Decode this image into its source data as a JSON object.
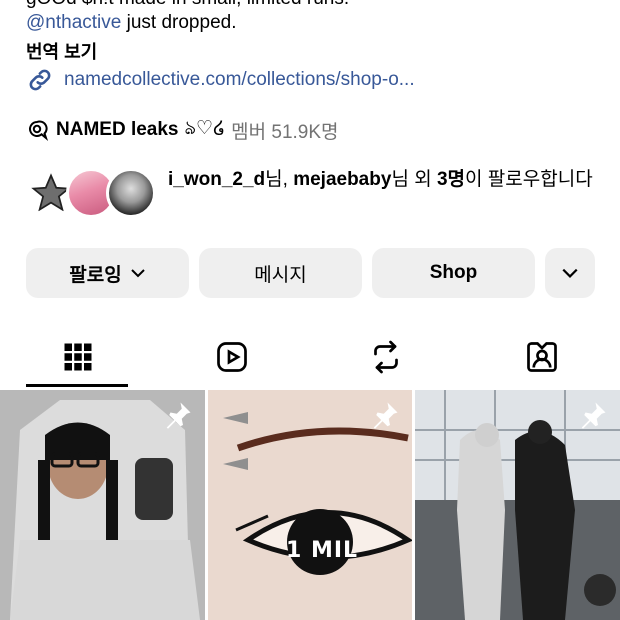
{
  "bio": {
    "cut_line": "gOOd $h!t made in small, limited runs.",
    "mention": "@nthactive",
    "after_mention": " just dropped.",
    "translate": "번역 보기",
    "link": "namedcollective.com/collections/shop-o..."
  },
  "channel": {
    "name": "NAMED leaks",
    "emoji": "ঌ♡໒",
    "meta": "멤버 51.9K명"
  },
  "followed_by": {
    "names": "i_won_2_d",
    "sep1": "님, ",
    "name2": "mejaebaby",
    "sep2": "님 외 ",
    "count": "3명",
    "suffix": "이 팔로우합니다"
  },
  "buttons": {
    "following": "팔로잉",
    "message": "메시지",
    "shop": "Shop"
  },
  "tabs": [
    "grid-icon",
    "reels-icon",
    "reposts-icon",
    "tagged-icon"
  ],
  "grid": {
    "post2_text": "1 MIL"
  }
}
